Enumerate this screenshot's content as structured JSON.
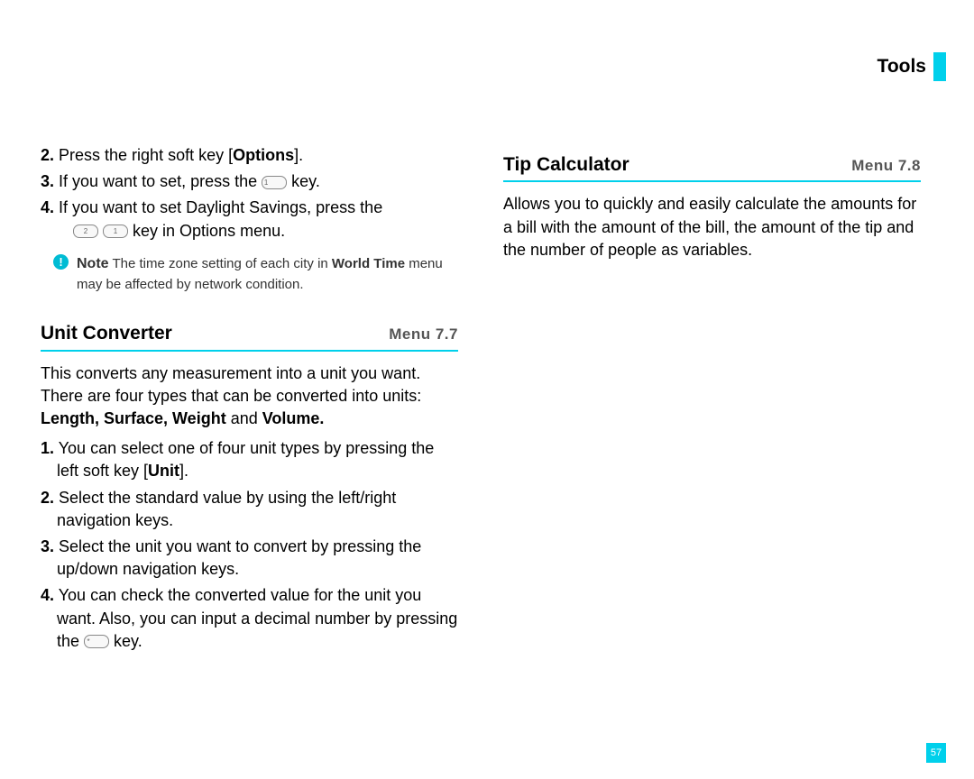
{
  "header": {
    "title": "Tools"
  },
  "left": {
    "step2_num": "2.",
    "step2_a": " Press the right soft key [",
    "step2_b": "Options",
    "step2_c": "].",
    "step3_num": "3.",
    "step3_a": " If you want to set, press the ",
    "step3_key": "1",
    "step3_b": " key.",
    "step4_num": "4.",
    "step4_a": " If you want to set Daylight Savings, press the ",
    "step4_key1": "2",
    "step4_key2": "1",
    "step4_b": " key in Options menu.",
    "note_label": "Note",
    "note_a": "  The time zone setting of each city in ",
    "note_b": "World Time",
    "note_c": " menu may be affected by network condition.",
    "unit_title": "Unit Converter",
    "unit_menu": "Menu 7.7",
    "unit_body_a": "This converts any measurement into a unit you want. There are four types that can be converted into units: ",
    "unit_body_b": "Length, Surface, Weight",
    "unit_body_c": " and ",
    "unit_body_d": "Volume.",
    "u1_num": "1.",
    "u1_a": " You can select one of four unit types by pressing the left soft key [",
    "u1_b": "Unit",
    "u1_c": "].",
    "u2_num": "2.",
    "u2": " Select the standard value by using the left/right navigation keys.",
    "u3_num": "3.",
    "u3": " Select the unit you want to convert by pressing the up/down navigation keys.",
    "u4_num": "4.",
    "u4_a": " You can check the converted value for the unit you want. Also, you can input a decimal number by pressing the ",
    "u4_key": "*",
    "u4_b": " key."
  },
  "right": {
    "tip_title": "Tip Calculator",
    "tip_menu": "Menu 7.8",
    "tip_body": "Allows you to quickly and easily calculate the amounts for a bill with the amount of the bill, the amount of the tip and the number of people as variables."
  },
  "page_num": "57"
}
